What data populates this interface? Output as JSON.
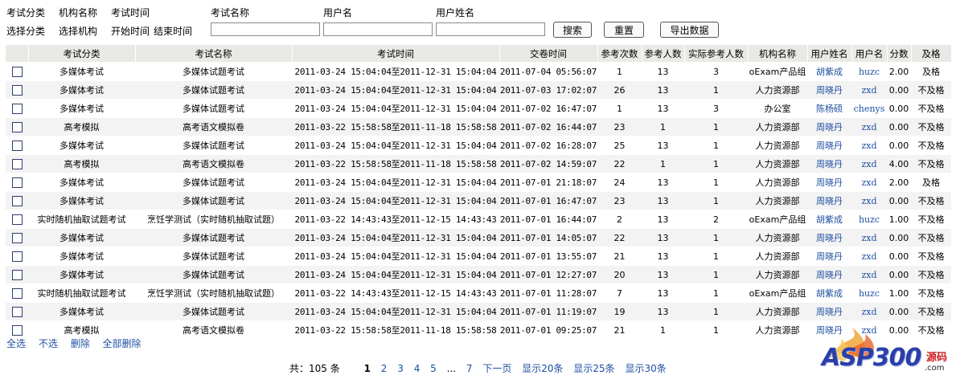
{
  "filters": {
    "labels": [
      "考试分类",
      "机构名称",
      "考试时间",
      "考试名称",
      "用户名",
      "用户姓名"
    ],
    "links": [
      "选择分类",
      "选择机构",
      "开始时间",
      "结束时间"
    ],
    "exam_name_value": "",
    "username_value": "",
    "realname_value": "",
    "buttons": {
      "search": "搜索",
      "reset": "重置",
      "export": "导出数据"
    }
  },
  "table": {
    "columns": [
      "",
      "考试分类",
      "考试名称",
      "考试时间",
      "交卷时间",
      "参考次数",
      "参考人数",
      "实际参考人数",
      "机构名称",
      "用户姓名",
      "用户名",
      "分数",
      "及格"
    ],
    "rows": [
      [
        "多媒体考试",
        "多媒体试题考试",
        "2011-03-24 15:04:04至2011-12-31 15:04:04",
        "2011-07-04 05:56:07",
        "1",
        "13",
        "3",
        "oExam产品组",
        "胡紫成",
        "huzc",
        "2.00",
        "及格"
      ],
      [
        "多媒体考试",
        "多媒体试题考试",
        "2011-03-24 15:04:04至2011-12-31 15:04:04",
        "2011-07-03 17:02:07",
        "26",
        "13",
        "1",
        "人力资源部",
        "周晓丹",
        "zxd",
        "0.00",
        "不及格"
      ],
      [
        "多媒体考试",
        "多媒体试题考试",
        "2011-03-24 15:04:04至2011-12-31 15:04:04",
        "2011-07-02 16:47:07",
        "1",
        "13",
        "3",
        "办公室",
        "陈杨硕",
        "chenys",
        "0.00",
        "不及格"
      ],
      [
        "高考模拟",
        "高考语文模拟卷",
        "2011-03-22 15:58:58至2011-11-18 15:58:58",
        "2011-07-02 16:44:07",
        "23",
        "1",
        "1",
        "人力资源部",
        "周晓丹",
        "zxd",
        "0.00",
        "不及格"
      ],
      [
        "多媒体考试",
        "多媒体试题考试",
        "2011-03-24 15:04:04至2011-12-31 15:04:04",
        "2011-07-02 16:28:07",
        "25",
        "13",
        "1",
        "人力资源部",
        "周晓丹",
        "zxd",
        "0.00",
        "不及格"
      ],
      [
        "高考模拟",
        "高考语文模拟卷",
        "2011-03-22 15:58:58至2011-11-18 15:58:58",
        "2011-07-02 14:59:07",
        "22",
        "1",
        "1",
        "人力资源部",
        "周晓丹",
        "zxd",
        "4.00",
        "不及格"
      ],
      [
        "多媒体考试",
        "多媒体试题考试",
        "2011-03-24 15:04:04至2011-12-31 15:04:04",
        "2011-07-01 21:18:07",
        "24",
        "13",
        "1",
        "人力资源部",
        "周晓丹",
        "zxd",
        "2.00",
        "及格"
      ],
      [
        "多媒体考试",
        "多媒体试题考试",
        "2011-03-24 15:04:04至2011-12-31 15:04:04",
        "2011-07-01 16:47:07",
        "23",
        "13",
        "1",
        "人力资源部",
        "周晓丹",
        "zxd",
        "0.00",
        "不及格"
      ],
      [
        "实时随机抽取试题考试",
        "烹饪学测试（实时随机抽取试题）",
        "2011-03-22 14:43:43至2011-12-15 14:43:43",
        "2011-07-01 16:44:07",
        "2",
        "13",
        "2",
        "oExam产品组",
        "胡紫成",
        "huzc",
        "1.00",
        "不及格"
      ],
      [
        "多媒体考试",
        "多媒体试题考试",
        "2011-03-24 15:04:04至2011-12-31 15:04:04",
        "2011-07-01 14:05:07",
        "22",
        "13",
        "1",
        "人力资源部",
        "周晓丹",
        "zxd",
        "0.00",
        "不及格"
      ],
      [
        "多媒体考试",
        "多媒体试题考试",
        "2011-03-24 15:04:04至2011-12-31 15:04:04",
        "2011-07-01 13:55:07",
        "21",
        "13",
        "1",
        "人力资源部",
        "周晓丹",
        "zxd",
        "0.00",
        "不及格"
      ],
      [
        "多媒体考试",
        "多媒体试题考试",
        "2011-03-24 15:04:04至2011-12-31 15:04:04",
        "2011-07-01 12:27:07",
        "20",
        "13",
        "1",
        "人力资源部",
        "周晓丹",
        "zxd",
        "0.00",
        "不及格"
      ],
      [
        "实时随机抽取试题考试",
        "烹饪学测试（实时随机抽取试题）",
        "2011-03-22 14:43:43至2011-12-15 14:43:43",
        "2011-07-01 11:28:07",
        "7",
        "13",
        "1",
        "oExam产品组",
        "胡紫成",
        "huzc",
        "1.00",
        "不及格"
      ],
      [
        "多媒体考试",
        "多媒体试题考试",
        "2011-03-24 15:04:04至2011-12-31 15:04:04",
        "2011-07-01 11:19:07",
        "19",
        "13",
        "1",
        "人力资源部",
        "周晓丹",
        "zxd",
        "0.00",
        "不及格"
      ],
      [
        "高考模拟",
        "高考语文模拟卷",
        "2011-03-22 15:58:58至2011-11-18 15:58:58",
        "2011-07-01 09:25:07",
        "21",
        "1",
        "1",
        "人力资源部",
        "周晓丹",
        "zxd",
        "0.00",
        "不及格"
      ]
    ]
  },
  "bulk_actions": [
    "全选",
    "不选",
    "删除",
    "全部删除"
  ],
  "pager": {
    "total": "共：105 条",
    "current": "1",
    "pages": [
      "2",
      "3",
      "4",
      "5"
    ],
    "ellipsis": "...",
    "last": "7",
    "next": "下一页",
    "sizes": [
      "显示20条",
      "显示25条",
      "显示30条"
    ]
  },
  "watermark": {
    "logo": "ASP300",
    "sub": "源码",
    "domain": ".com"
  }
}
